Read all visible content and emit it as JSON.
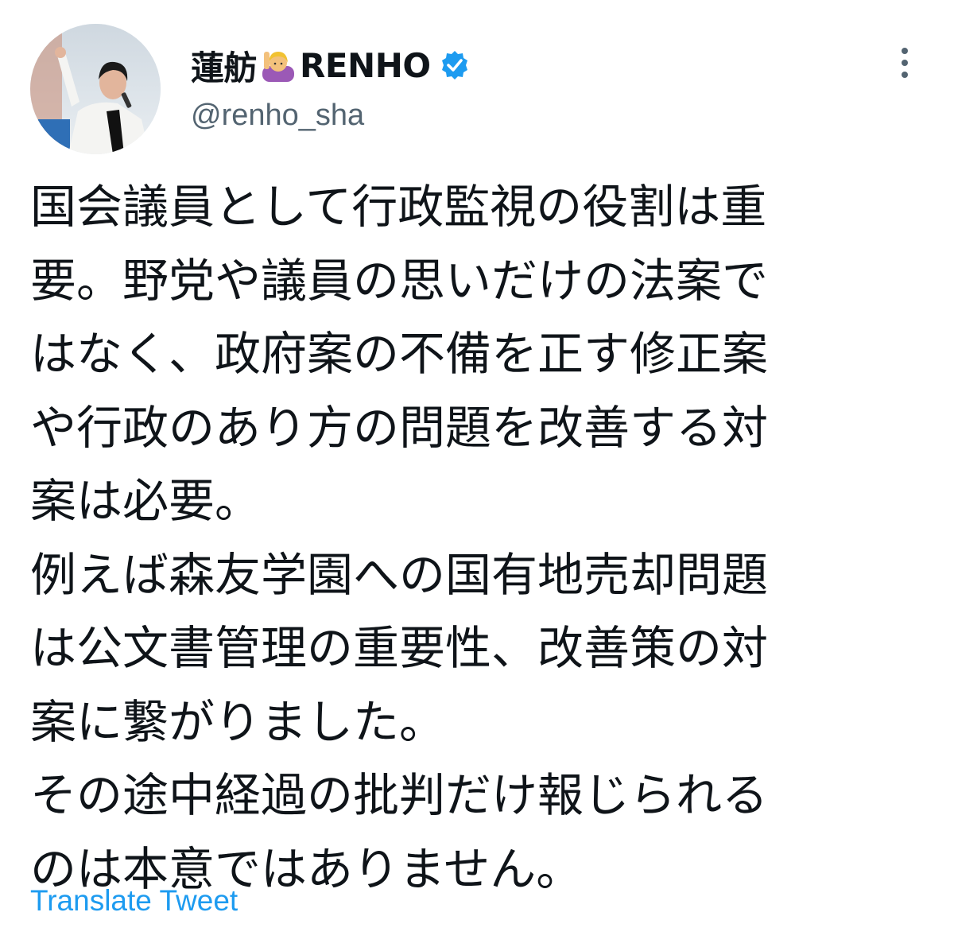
{
  "author": {
    "display_name": "蓮舫",
    "display_name_suffix": "RENHO",
    "emoji_icon": "woman-raising-hand-emoji",
    "verified_icon": "verified-badge-icon",
    "handle": "@renho_sha",
    "avatar_icon": "profile-photo-avatar"
  },
  "menu": {
    "more_icon": "more-vertical-icon"
  },
  "tweet": {
    "lines": [
      "国会議員として行政監視の役割は重",
      "要。野党や議員の思いだけの法案で",
      "はなく、政府案の不備を正す修正案",
      "や行政のあり方の問題を改善する対",
      "案は必要。",
      "例えば森友学園への国有地売却問題",
      "は公文書管理の重要性、改善策の対",
      "案に繋がりました。",
      "その途中経過の批判だけ報じられる",
      "のは本意ではありません。"
    ]
  },
  "actions": {
    "translate_label": "Translate Tweet"
  },
  "colors": {
    "link": "#1d9bf0",
    "secondary_text": "#536471",
    "verified": "#1d9bf0"
  }
}
